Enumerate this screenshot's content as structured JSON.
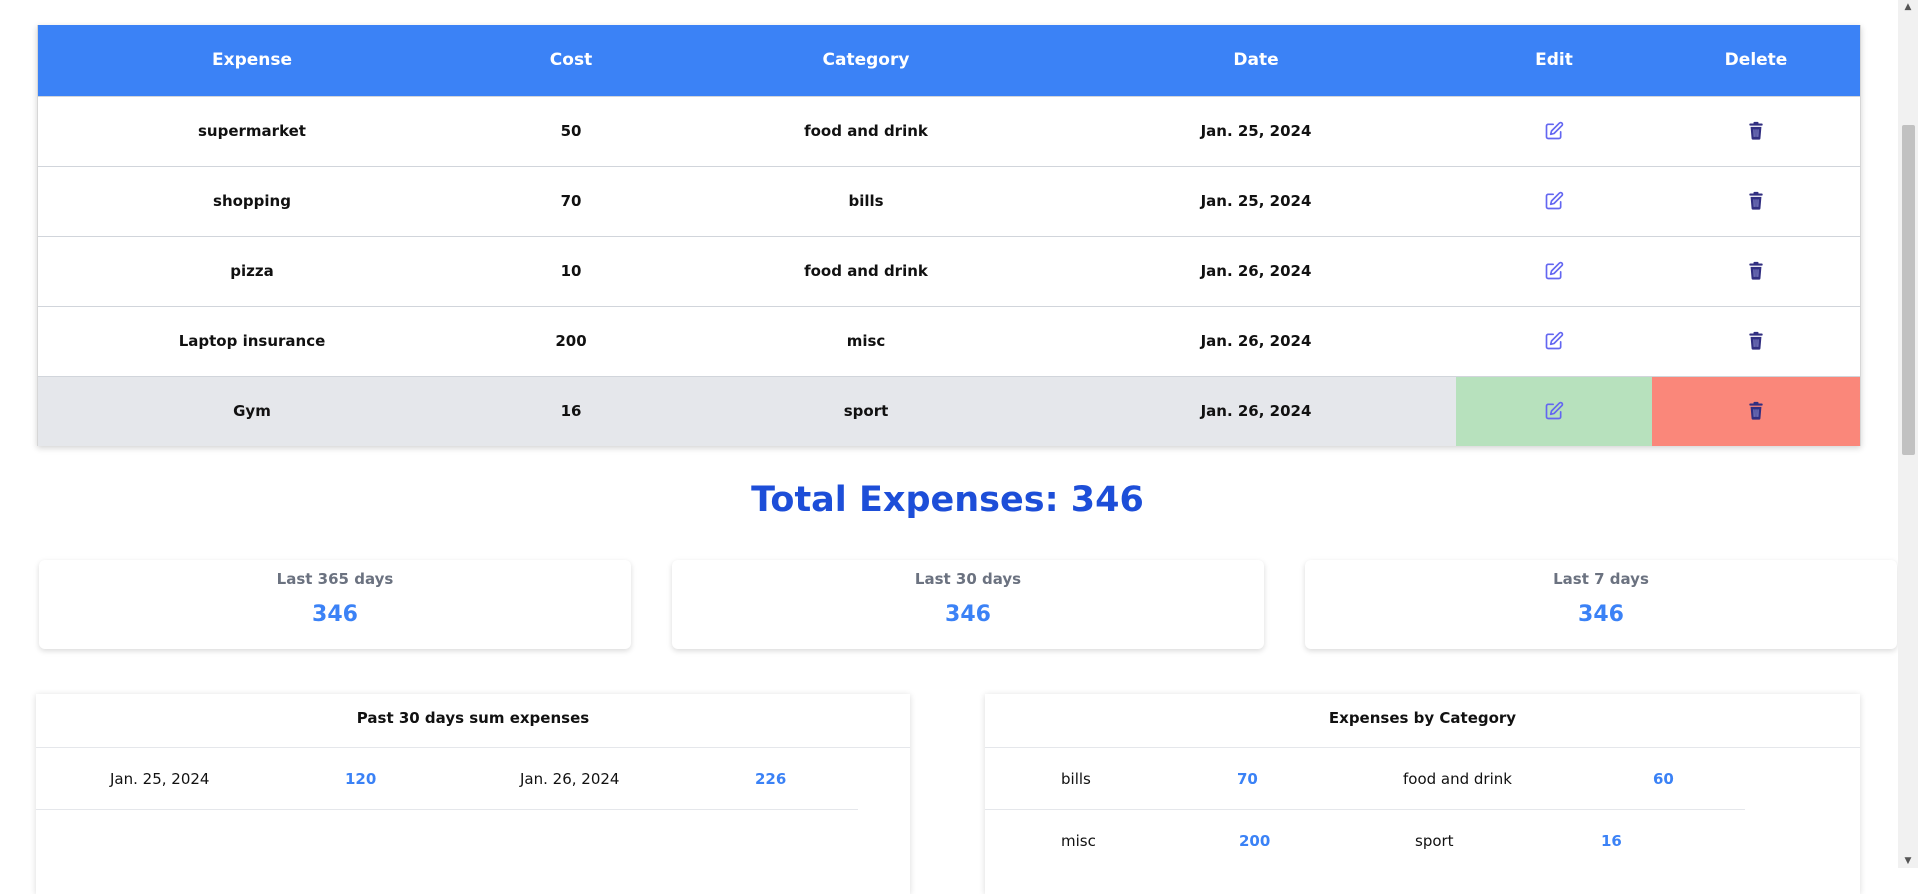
{
  "table": {
    "headers": [
      "Expense",
      "Cost",
      "Category",
      "Date",
      "Edit",
      "Delete"
    ],
    "rows": [
      {
        "expense": "supermarket",
        "cost": "50",
        "category": "food and drink",
        "date": "Jan. 25, 2024"
      },
      {
        "expense": "shopping",
        "cost": "70",
        "category": "bills",
        "date": "Jan. 25, 2024"
      },
      {
        "expense": "pizza",
        "cost": "10",
        "category": "food and drink",
        "date": "Jan. 26, 2024"
      },
      {
        "expense": "Laptop insurance",
        "cost": "200",
        "category": "misc",
        "date": "Jan. 26, 2024"
      },
      {
        "expense": "Gym",
        "cost": "16",
        "category": "sport",
        "date": "Jan. 26, 2024"
      }
    ],
    "edit_icon": "edit-icon",
    "delete_icon": "trash-icon"
  },
  "total": {
    "label": "Total Expenses: 346"
  },
  "stats": [
    {
      "label": "Last 365 days",
      "value": "346"
    },
    {
      "label": "Last 30 days",
      "value": "346"
    },
    {
      "label": "Last 7 days",
      "value": "346"
    }
  ],
  "past30": {
    "title": "Past 30 days sum expenses",
    "items": [
      {
        "date": "Jan. 25, 2024",
        "amount": "120"
      },
      {
        "date": "Jan. 26, 2024",
        "amount": "226"
      }
    ]
  },
  "byCategory": {
    "title": "Expenses by Category",
    "items": [
      {
        "category": "bills",
        "amount": "70"
      },
      {
        "category": "food and drink",
        "amount": "60"
      },
      {
        "category": "misc",
        "amount": "200"
      },
      {
        "category": "sport",
        "amount": "16"
      }
    ]
  },
  "colors": {
    "header": "#3b82f6",
    "total": "#1d4ed8",
    "value": "#3b82f6",
    "edit_hover": "#b7e1bd",
    "delete_hover": "#fa877a",
    "edit_icon": "#6366f1",
    "delete_icon": "#312e81"
  }
}
